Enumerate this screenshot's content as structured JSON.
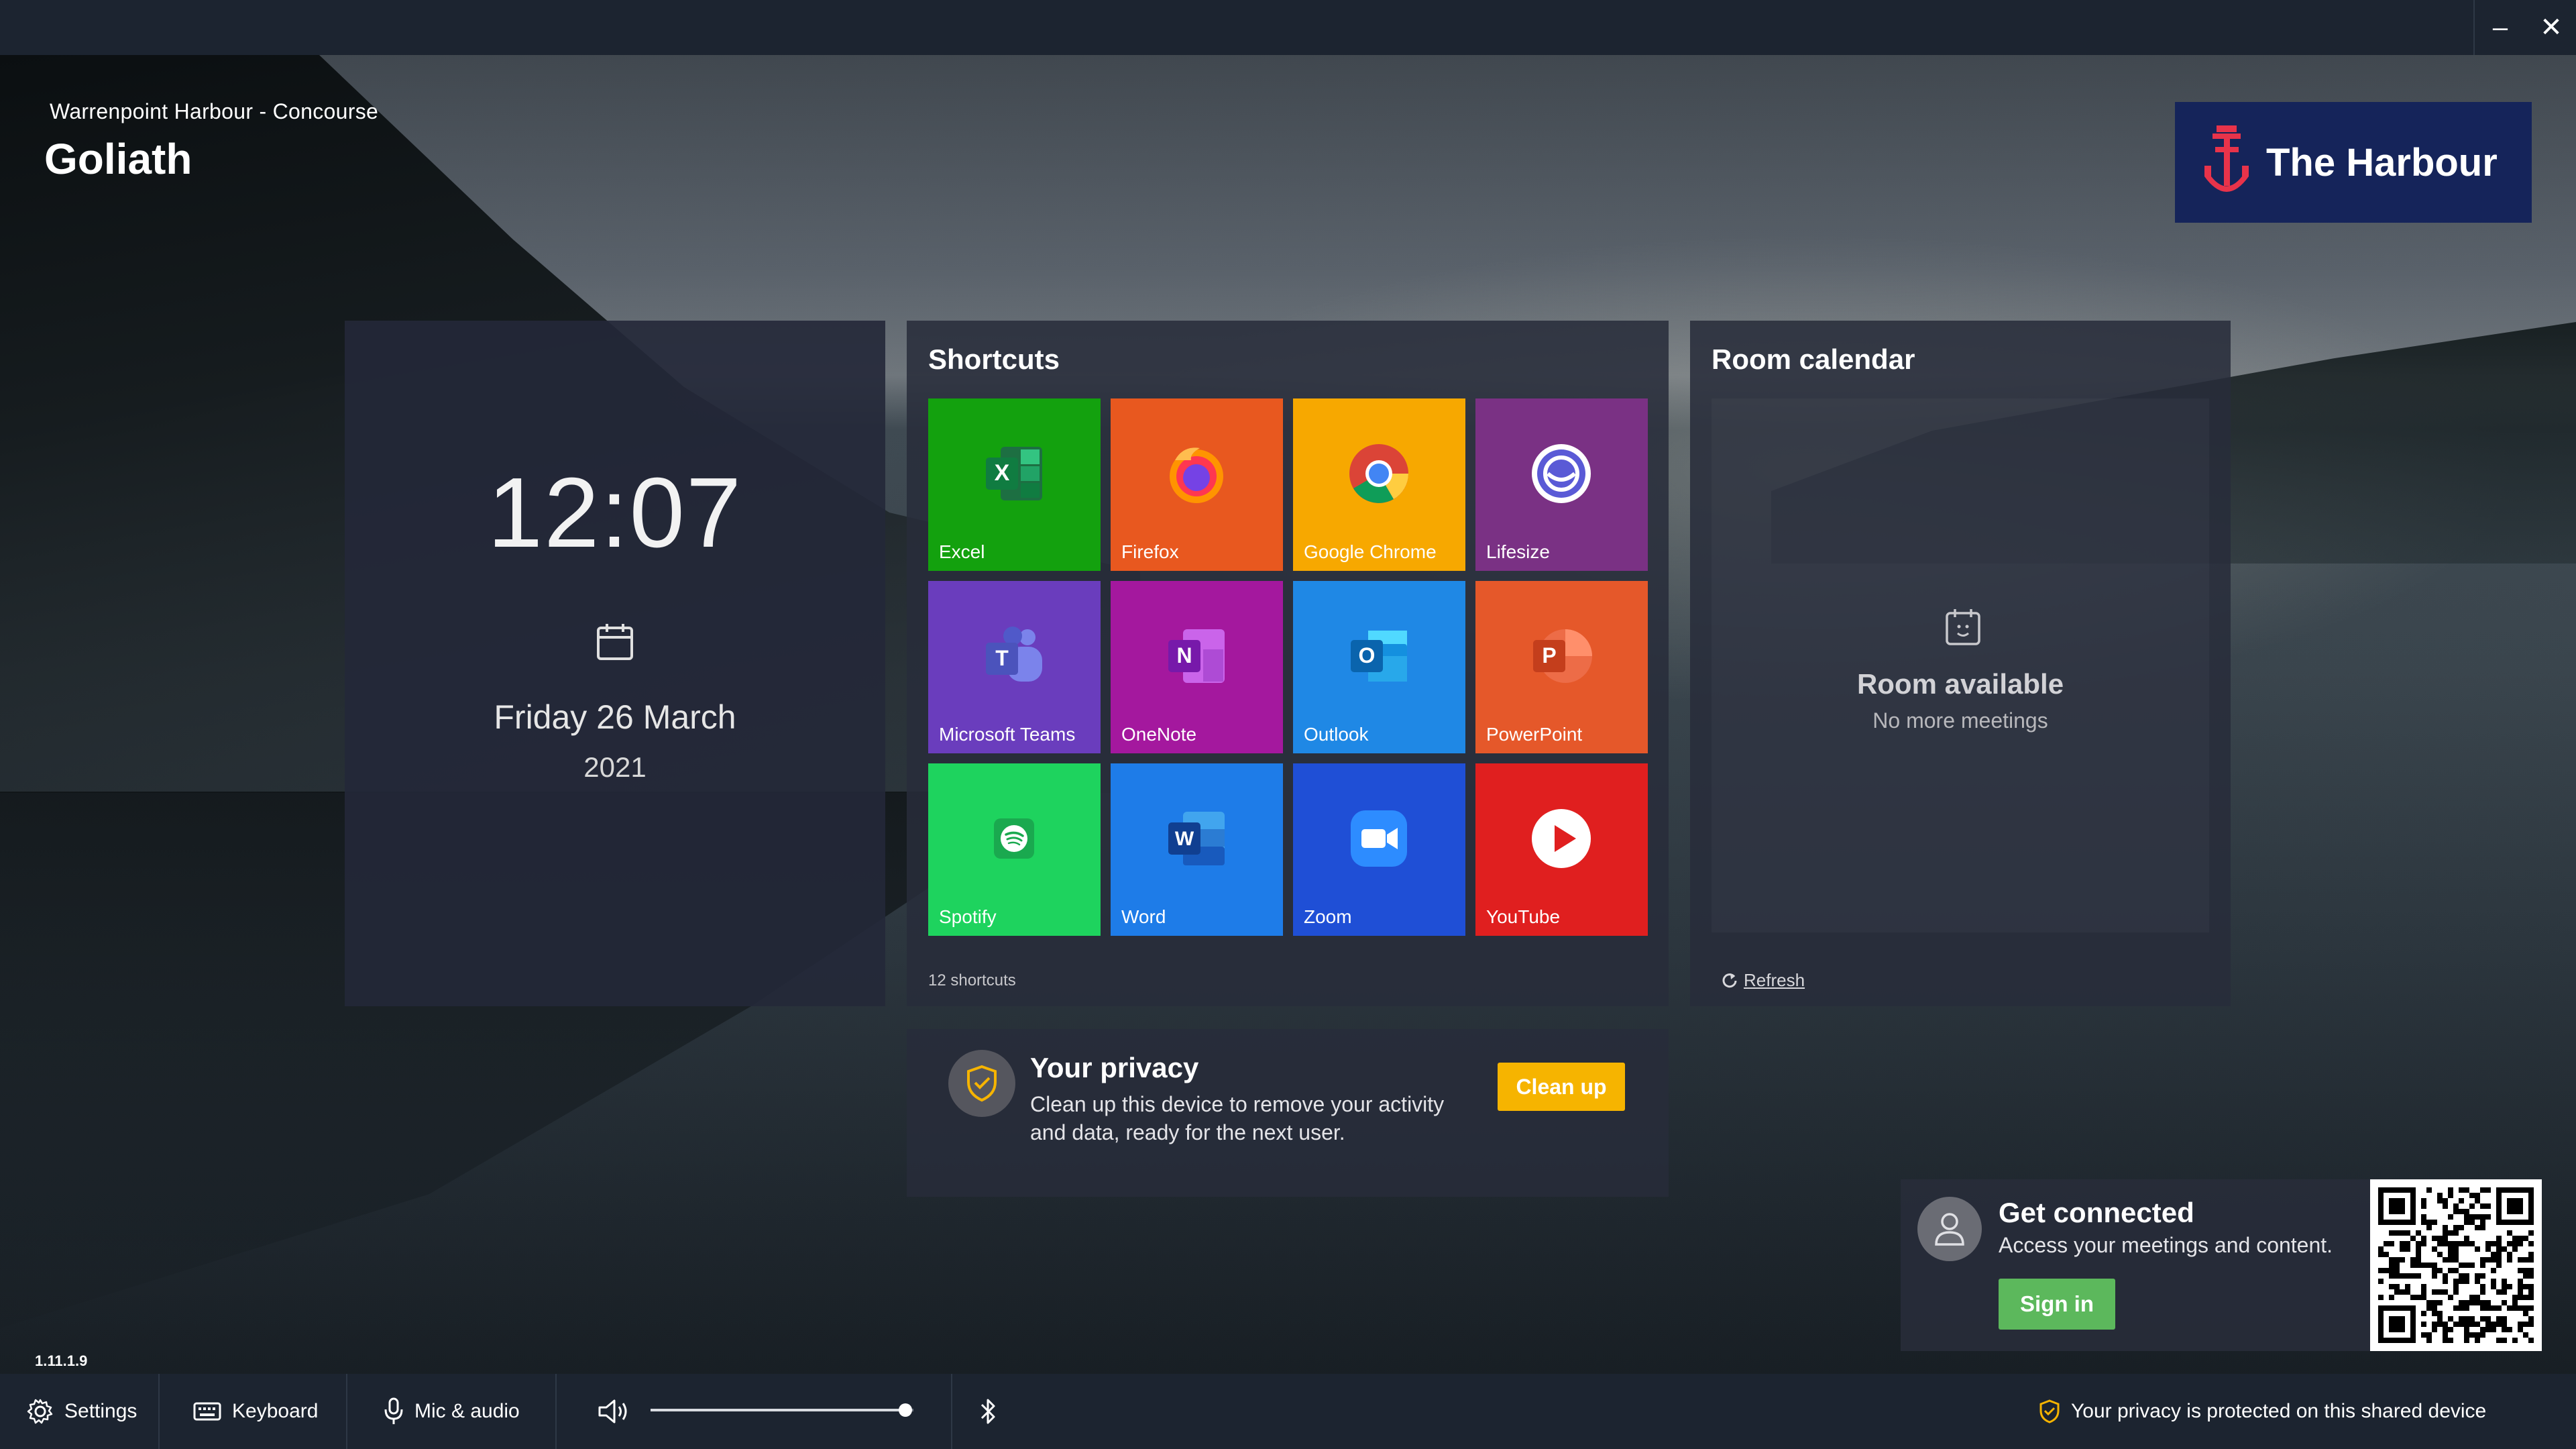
{
  "header": {
    "location": "Warrenpoint Harbour - Concourse",
    "room_name": "Goliath",
    "brand_name": "The Harbour",
    "brand_color": "#15245a",
    "accent_color": "#e8334a"
  },
  "window_controls": {
    "minimize": "–",
    "close": "✕"
  },
  "clock": {
    "time": "12:07",
    "date": "Friday 26 March",
    "year": "2021"
  },
  "shortcuts": {
    "title": "Shortcuts",
    "count_label": "12 shortcuts",
    "tiles": [
      {
        "label": "Excel",
        "color": "#13a10e",
        "icon": "excel-icon"
      },
      {
        "label": "Firefox",
        "color": "#e8581f",
        "icon": "firefox-icon"
      },
      {
        "label": "Google Chrome",
        "color": "#f7a800",
        "icon": "chrome-icon"
      },
      {
        "label": "Lifesize",
        "color": "#7a3184",
        "icon": "lifesize-icon"
      },
      {
        "label": "Microsoft Teams",
        "color": "#6a3dbd",
        "icon": "teams-icon"
      },
      {
        "label": "OneNote",
        "color": "#a4189e",
        "icon": "onenote-icon"
      },
      {
        "label": "Outlook",
        "color": "#1f88e5",
        "icon": "outlook-icon"
      },
      {
        "label": "PowerPoint",
        "color": "#e5582a",
        "icon": "powerpoint-icon"
      },
      {
        "label": "Spotify",
        "color": "#1ed35e",
        "icon": "spotify-icon"
      },
      {
        "label": "Word",
        "color": "#1e7ce8",
        "icon": "word-icon"
      },
      {
        "label": "Zoom",
        "color": "#1f4fd6",
        "icon": "zoom-icon"
      },
      {
        "label": "YouTube",
        "color": "#e01f1f",
        "icon": "youtube-icon"
      }
    ]
  },
  "room_calendar": {
    "title": "Room calendar",
    "status": "Room available",
    "subtitle": "No more meetings",
    "refresh_label": "Refresh"
  },
  "privacy": {
    "title": "Your privacy",
    "line1": "Clean up this device to remove your activity",
    "line2": "and data, ready for the next user.",
    "button_label": "Clean up"
  },
  "get_connected": {
    "title": "Get connected",
    "subtitle": "Access your meetings and content.",
    "button_label": "Sign in"
  },
  "version": "1.11.1.9",
  "bottom_bar": {
    "settings": "Settings",
    "keyboard": "Keyboard",
    "mic_audio": "Mic & audio",
    "volume_level": 0.97,
    "privacy_notice": "Your privacy is protected on this shared device"
  }
}
